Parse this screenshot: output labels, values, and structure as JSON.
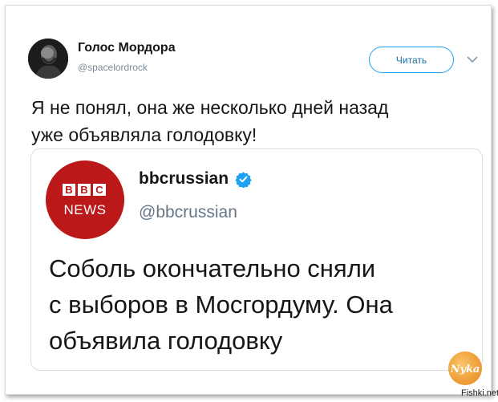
{
  "tweet": {
    "author_name": "Голос Мордора",
    "author_handle": "@spacelordrock",
    "follow_label": "Читать",
    "text_lines": [
      "Я не понял, она же несколько дней назад",
      "уже объявляла голодовку!"
    ]
  },
  "quoted_tweet": {
    "logo_letters": [
      "B",
      "B",
      "C"
    ],
    "logo_news": "NEWS",
    "author_name": "bbcrussian",
    "author_handle": "@bbcrussian",
    "text_lines": [
      "Соболь окончательно сняли",
      "с выборов в Мосгордуму. Она",
      "объявила голодовку"
    ]
  },
  "watermark": {
    "badge_text": "Nyka",
    "site": "Fishki.net"
  },
  "colors": {
    "accent": "#1da1f2",
    "bbc_red": "#bb1919",
    "watermark_orange": "#f0a03a"
  },
  "icons": {
    "follow_menu": "chevron-down-icon",
    "verified": "verified-badge-icon"
  }
}
